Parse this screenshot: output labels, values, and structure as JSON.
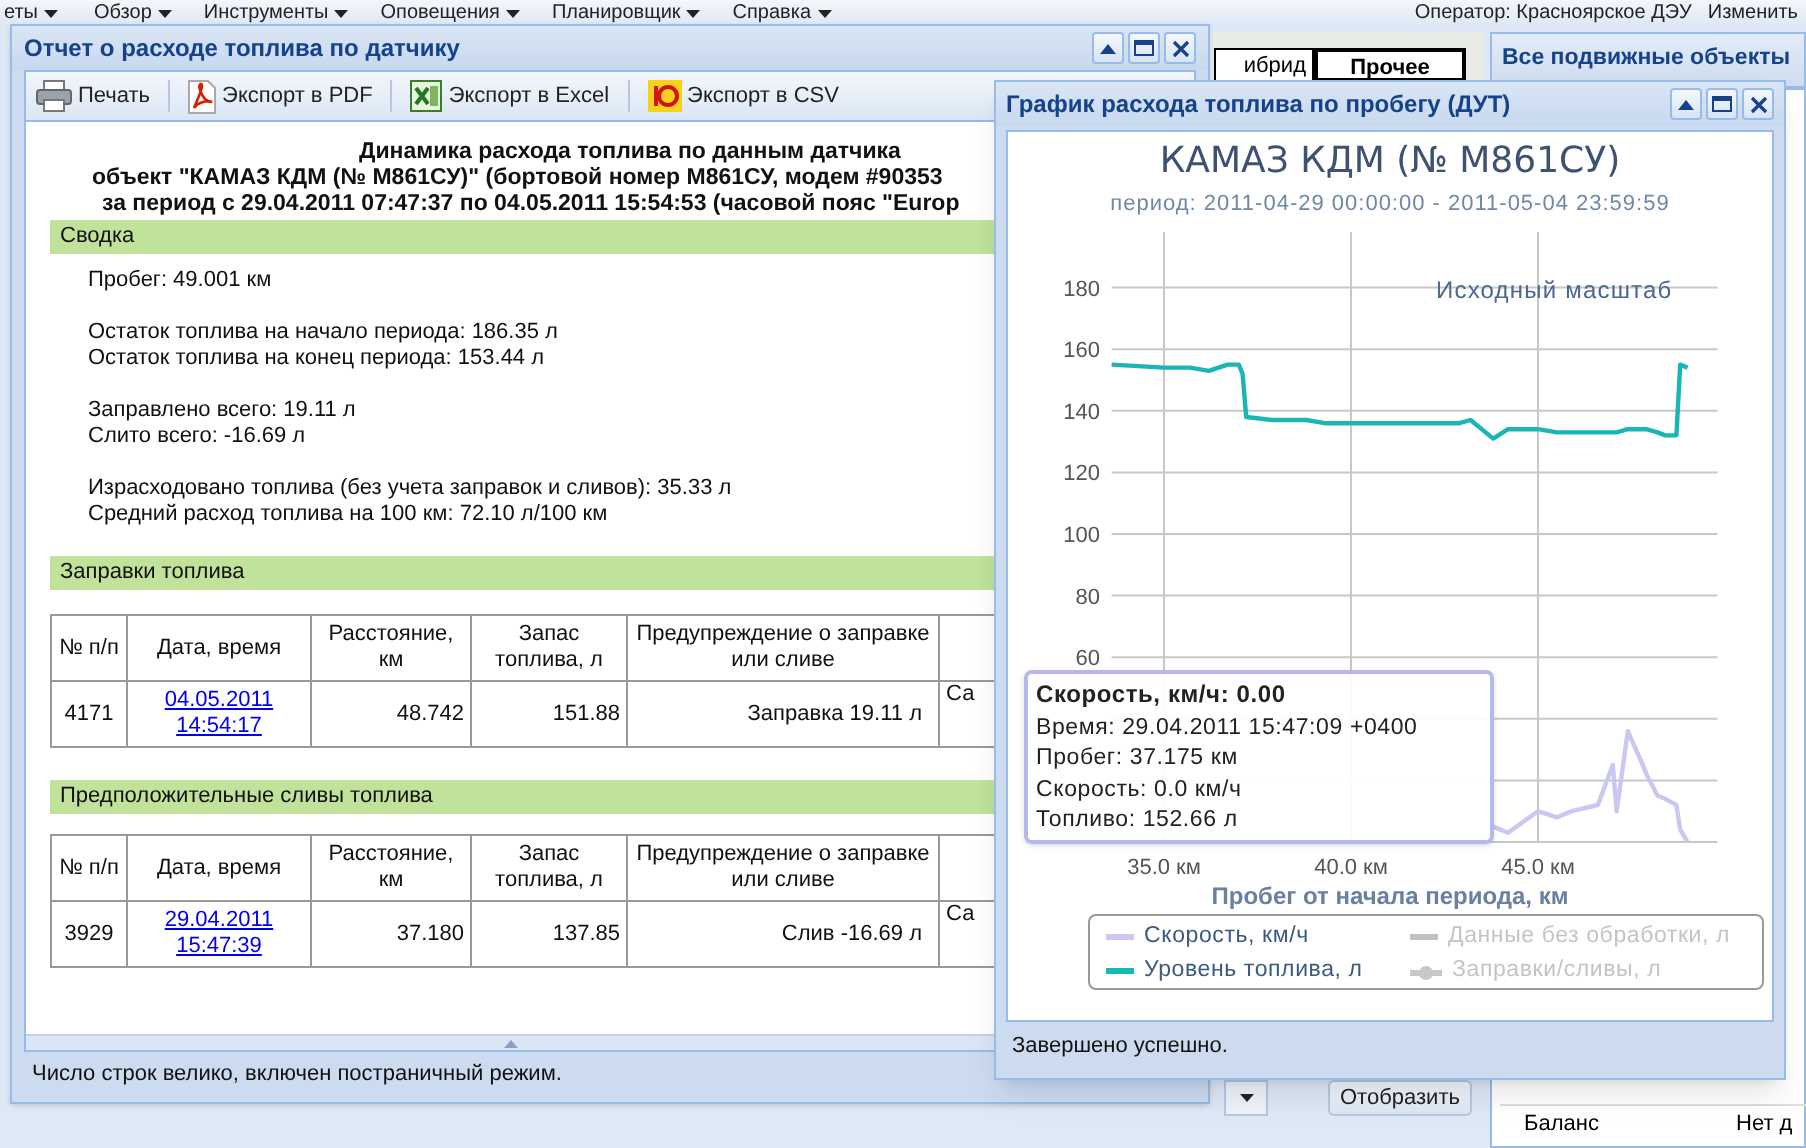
{
  "app_menu": [
    {
      "label": "еты"
    },
    {
      "label": "Обзор"
    },
    {
      "label": "Инструменты"
    },
    {
      "label": "Оповещения"
    },
    {
      "label": "Планировщик"
    },
    {
      "label": "Справка"
    }
  ],
  "operator": "Оператор: Красноярское ДЭУ",
  "change_link": "Изменить",
  "map_tabs": [
    {
      "label": "ибрид",
      "selected": false
    },
    {
      "label": "Прочее",
      "selected": true
    }
  ],
  "objects_panel_title": "Все подвижные объекты",
  "show_button": "Отобразить",
  "info_rows": [
    {
      "label": "Баланс",
      "value": "Нет д"
    }
  ],
  "report_window": {
    "title": "Отчет о расходе топлива по датчику",
    "toolbar": [
      {
        "kind": "print",
        "label": "Печать"
      },
      {
        "kind": "pdf",
        "label": "Экспорт в PDF"
      },
      {
        "kind": "excel",
        "label": "Экспорт в Excel"
      },
      {
        "kind": "csv",
        "label": "Экспорт в CSV"
      }
    ],
    "heading": [
      "Динамика расхода топлива по данным датчика",
      "объект \"КАМАЗ КДМ (№ М861СУ)\" (бортовой номер М861СУ, модем #90353",
      "за период с 29.04.2011 07:47:37 по 04.05.2011 15:54:53 (часовой пояс \"Europ"
    ],
    "sections": [
      {
        "kind": "summary",
        "title": "Сводка",
        "groups": [
          [
            "Пробег: 49.001 км"
          ],
          [
            "Остаток топлива на начало периода: 186.35 л",
            "Остаток топлива на конец периода: 153.44 л"
          ],
          [
            "Заправлено всего: 19.11 л",
            "Слито всего: -16.69 л"
          ],
          [
            "Израсходовано топлива (без учета заправок и сливов): 35.33 л",
            "Средний расход топлива на 100 км: 72.10 л/100 км"
          ]
        ]
      },
      {
        "kind": "table",
        "title": "Заправки топлива",
        "columns": [
          "№ п/п",
          "Дата, время",
          "Расстояние, км",
          "Запас топлива, л",
          "Предупреждение о заправке или сливе"
        ],
        "rows": [
          {
            "number": "4171",
            "date": "04.05.2011",
            "time": "14:54:17",
            "distance": "48.742",
            "fuel": "151.88",
            "warning": "Заправка 19.11 л",
            "column_6": "Са"
          }
        ]
      },
      {
        "kind": "table",
        "title": "Предположительные сливы топлива",
        "columns": [
          "№ п/п",
          "Дата, время",
          "Расстояние, км",
          "Запас топлива, л",
          "Предупреждение о заправке или сливе"
        ],
        "rows": [
          {
            "number": "3929",
            "date": "29.04.2011",
            "time": "15:47:39",
            "distance": "37.180",
            "fuel": "137.85",
            "warning": "Слив -16.69 л",
            "column_6": "Са"
          }
        ]
      }
    ],
    "status": "Число строк велико, включен постраничный режим."
  },
  "chart_window": {
    "title": "График расхода топлива по пробегу (ДУТ)",
    "chart_subtitle": "период: 2011-04-29 00:00:00 - 2011-05-04 23:59:59",
    "reset_zoom": "Исходный масштаб",
    "chart_data": {
      "type": "line",
      "title": "КАМАЗ КДМ (№ М861СУ)",
      "xlabel": "Пробег от начала периода, км",
      "x": [
        33.6,
        35.0,
        35.7,
        36.2,
        36.7,
        37.0,
        37.1,
        37.2,
        37.9,
        38.8,
        39.3,
        40.0,
        41.1,
        42.0,
        42.9,
        43.2,
        43.8,
        44.2,
        45.0,
        45.5,
        45.9,
        46.6,
        47.0,
        47.1,
        47.4,
        47.8,
        47.9,
        48.2,
        48.4,
        48.7,
        48.8,
        49.0
      ],
      "series": [
        {
          "name": "Скорость, км/ч",
          "color": "#c8c8f0",
          "values": [
            null,
            null,
            null,
            null,
            null,
            null,
            null,
            null,
            null,
            null,
            null,
            null,
            null,
            null,
            null,
            null,
            5,
            3,
            10,
            8,
            10,
            12,
            25,
            10,
            36,
            25,
            22,
            15,
            14,
            12,
            4,
            0
          ]
        },
        {
          "name": "Уровень топлива, л",
          "color": "#1ab5b5",
          "values": [
            155,
            154,
            154,
            153,
            155,
            155,
            152,
            138,
            137,
            137,
            136,
            136,
            136,
            136,
            136,
            137,
            131,
            134,
            134,
            133,
            133,
            133,
            133,
            133,
            134,
            134,
            134,
            133,
            132,
            132,
            155,
            154
          ]
        }
      ],
      "xlim": [
        33.6,
        49.8
      ],
      "ylim": [
        0,
        180
      ],
      "grid": true,
      "xticks": [
        {
          "value": 35,
          "label": "35.0 км"
        },
        {
          "value": 40,
          "label": "40.0 км"
        },
        {
          "value": 45,
          "label": "45.0 км"
        }
      ],
      "yticks": [
        60,
        80,
        100,
        120,
        140,
        160,
        180
      ]
    },
    "tooltip": {
      "title": "Скорость, км/ч: 0.00",
      "lines": [
        "Время: 29.04.2011 15:47:09 +0400",
        "Пробег: 37.175 км",
        "Скорость: 0.0 км/ч",
        "Топливо: 152.66 л"
      ]
    },
    "legend": [
      {
        "kind": "series"
      },
      {
        "kind": "line",
        "label": "Данные без обработки, л",
        "color": "#c0c0c0",
        "enabled": false
      },
      {
        "kind": "series"
      },
      {
        "kind": "marker",
        "label": "Заправки/сливы, л",
        "color": "#c8c8c8",
        "enabled": false
      }
    ],
    "status": "Завершено успешно."
  }
}
